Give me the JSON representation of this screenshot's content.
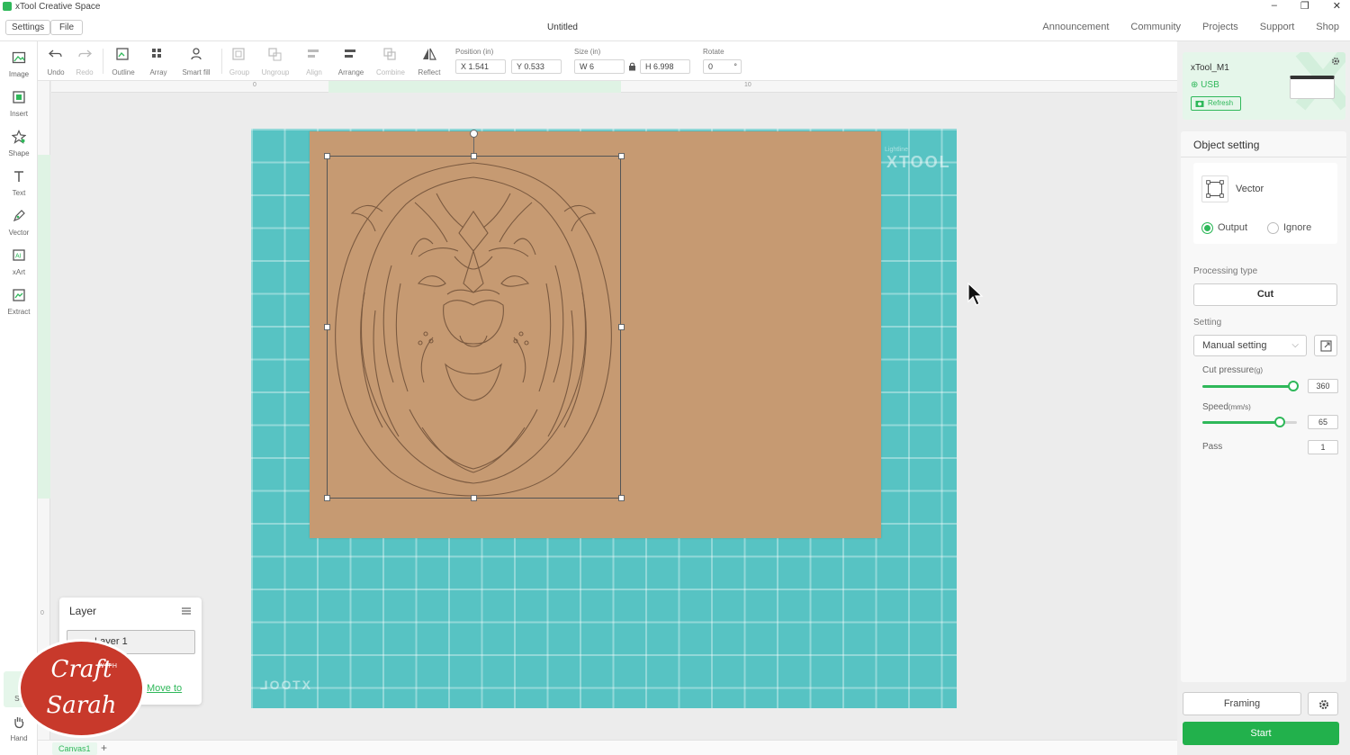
{
  "titlebar": {
    "app_title": "xTool Creative Space",
    "controls": [
      "minimize-icon",
      "restore-icon",
      "close-icon"
    ]
  },
  "menubar": {
    "settings_label": "Settings",
    "file_label": "File",
    "doc_title": "Untitled",
    "nav": [
      "Announcement",
      "Community",
      "Projects",
      "Support",
      "Shop"
    ]
  },
  "left_tools": [
    {
      "label": "Image",
      "icon": "image-icon"
    },
    {
      "label": "Insert",
      "icon": "insert-icon"
    },
    {
      "label": "Shape",
      "icon": "shape-icon"
    },
    {
      "label": "Text",
      "icon": "text-icon"
    },
    {
      "label": "Vector",
      "icon": "pen-icon"
    },
    {
      "label": "xArt",
      "icon": "ai-icon"
    },
    {
      "label": "Extract",
      "icon": "extract-icon"
    }
  ],
  "bottom_left_tools": {
    "select_label": "Se",
    "hand_label": "Hand"
  },
  "top_tools": {
    "undo": "Undo",
    "redo": "Redo",
    "outline": "Outline",
    "array": "Array",
    "smart_fill": "Smart fill",
    "group": "Group",
    "ungroup": "Ungroup",
    "align": "Align",
    "arrange": "Arrange",
    "combine": "Combine",
    "reflect": "Reflect"
  },
  "position": {
    "label": "Position (in)",
    "x": "X 1.541",
    "y": "Y 0.533"
  },
  "size": {
    "label": "Size (in)",
    "w": "W 6",
    "h": "H 6.998"
  },
  "rotate": {
    "label": "Rotate",
    "value": "0",
    "unit": "°"
  },
  "rulers": {
    "top_ticks": [
      "0",
      "10"
    ],
    "left_ticks": [
      "0"
    ]
  },
  "mat": {
    "brand": "XTOOL",
    "brand_mirrored": "XTOOL",
    "sub": "Lightline"
  },
  "layer_panel": {
    "title": "Layer",
    "item": "Layer 1",
    "move_to": "Move to"
  },
  "watermark": {
    "line1": "Craft",
    "line2": "Sarah",
    "with": "WITH"
  },
  "canvas_tabs": {
    "tab": "Canvas1",
    "add": "+"
  },
  "device": {
    "name": "xTool_M1",
    "connection": "USB",
    "refresh": "Refresh"
  },
  "object_setting": {
    "title": "Object setting",
    "type": "Vector",
    "output_label": "Output",
    "ignore_label": "Ignore",
    "output_selected": true,
    "processing_type_label": "Processing type",
    "processing_type": "Cut",
    "setting_label": "Setting",
    "setting_value": "Manual setting",
    "cut_pressure_label": "Cut pressure",
    "cut_pressure_unit": "(g)",
    "cut_pressure": "360",
    "cut_pressure_fraction": 0.96,
    "speed_label": "Speed",
    "speed_unit": "(mm/s)",
    "speed": "65",
    "speed_fraction": 0.82,
    "pass_label": "Pass",
    "pass": "1"
  },
  "actions": {
    "framing": "Framing",
    "start": "Start"
  },
  "colors": {
    "accent": "#2fb85a",
    "start": "#22b14c",
    "mat": "#57c3c3",
    "board": "#c69a72"
  }
}
